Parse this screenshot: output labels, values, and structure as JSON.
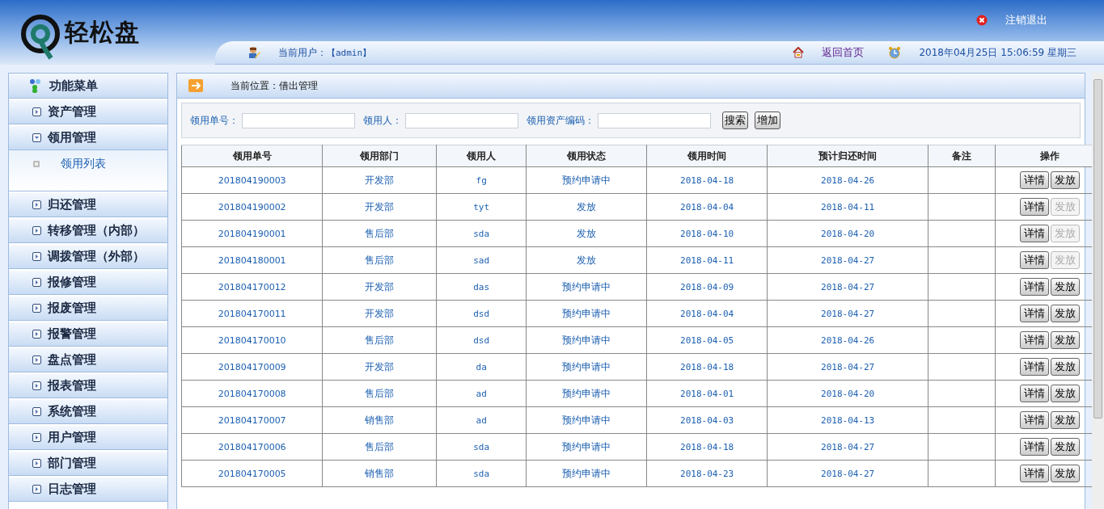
{
  "header": {
    "logo_text": "轻松盘",
    "logout": "注销退出",
    "current_user_label": "当前用户：",
    "current_user": "【admin】",
    "home_link": "返回首页",
    "datetime": "2018年04月25日 15:06:59 星期三"
  },
  "sidebar": {
    "title": "功能菜单",
    "items": [
      {
        "label": "资产管理",
        "expanded": false
      },
      {
        "label": "领用管理",
        "expanded": true,
        "children": [
          {
            "label": "领用列表"
          }
        ]
      },
      {
        "label": "归还管理",
        "expanded": false
      },
      {
        "label": "转移管理（内部）",
        "expanded": false
      },
      {
        "label": "调拨管理（外部）",
        "expanded": false
      },
      {
        "label": "报修管理",
        "expanded": false
      },
      {
        "label": "报废管理",
        "expanded": false
      },
      {
        "label": "报警管理",
        "expanded": false
      },
      {
        "label": "盘点管理",
        "expanded": false
      },
      {
        "label": "报表管理",
        "expanded": false
      },
      {
        "label": "系统管理",
        "expanded": false
      },
      {
        "label": "用户管理",
        "expanded": false
      },
      {
        "label": "部门管理",
        "expanded": false
      },
      {
        "label": "日志管理",
        "expanded": false
      }
    ]
  },
  "breadcrumb": "当前位置：借出管理",
  "search": {
    "fields": [
      {
        "label": "领用单号："
      },
      {
        "label": "领用人："
      },
      {
        "label": "领用资产编码："
      }
    ],
    "buttons": [
      "搜索",
      "增加"
    ]
  },
  "table": {
    "columns": [
      "领用单号",
      "领用部门",
      "领用人",
      "领用状态",
      "领用时间",
      "预计归还时间",
      "备注",
      "操作"
    ],
    "rows": [
      {
        "cells": [
          "201804190003",
          "开发部",
          "fg",
          "预约申请中",
          "2018-04-18",
          "2018-04-26",
          ""
        ],
        "actions": [
          {
            "label": "详情",
            "disabled": false
          },
          {
            "label": "发放",
            "disabled": false
          }
        ]
      },
      {
        "cells": [
          "201804190002",
          "开发部",
          "tyt",
          "发放",
          "2018-04-04",
          "2018-04-11",
          ""
        ],
        "actions": [
          {
            "label": "详情",
            "disabled": false
          },
          {
            "label": "发放",
            "disabled": true
          }
        ]
      },
      {
        "cells": [
          "201804190001",
          "售后部",
          "sda",
          "发放",
          "2018-04-10",
          "2018-04-20",
          ""
        ],
        "actions": [
          {
            "label": "详情",
            "disabled": false
          },
          {
            "label": "发放",
            "disabled": true
          }
        ]
      },
      {
        "cells": [
          "201804180001",
          "售后部",
          "sad",
          "发放",
          "2018-04-11",
          "2018-04-27",
          ""
        ],
        "actions": [
          {
            "label": "详情",
            "disabled": false
          },
          {
            "label": "发放",
            "disabled": true
          }
        ]
      },
      {
        "cells": [
          "201804170012",
          "开发部",
          "das",
          "预约申请中",
          "2018-04-09",
          "2018-04-27",
          ""
        ],
        "actions": [
          {
            "label": "详情",
            "disabled": false
          },
          {
            "label": "发放",
            "disabled": false
          }
        ]
      },
      {
        "cells": [
          "201804170011",
          "开发部",
          "dsd",
          "预约申请中",
          "2018-04-04",
          "2018-04-27",
          ""
        ],
        "actions": [
          {
            "label": "详情",
            "disabled": false
          },
          {
            "label": "发放",
            "disabled": false
          }
        ]
      },
      {
        "cells": [
          "201804170010",
          "售后部",
          "dsd",
          "预约申请中",
          "2018-04-05",
          "2018-04-26",
          ""
        ],
        "actions": [
          {
            "label": "详情",
            "disabled": false
          },
          {
            "label": "发放",
            "disabled": false
          }
        ]
      },
      {
        "cells": [
          "201804170009",
          "开发部",
          "da",
          "预约申请中",
          "2018-04-18",
          "2018-04-27",
          ""
        ],
        "actions": [
          {
            "label": "详情",
            "disabled": false
          },
          {
            "label": "发放",
            "disabled": false
          }
        ]
      },
      {
        "cells": [
          "201804170008",
          "售后部",
          "ad",
          "预约申请中",
          "2018-04-01",
          "2018-04-20",
          ""
        ],
        "actions": [
          {
            "label": "详情",
            "disabled": false
          },
          {
            "label": "发放",
            "disabled": false
          }
        ]
      },
      {
        "cells": [
          "201804170007",
          "销售部",
          "ad",
          "预约申请中",
          "2018-04-03",
          "2018-04-13",
          ""
        ],
        "actions": [
          {
            "label": "详情",
            "disabled": false
          },
          {
            "label": "发放",
            "disabled": false
          }
        ]
      },
      {
        "cells": [
          "201804170006",
          "售后部",
          "sda",
          "预约申请中",
          "2018-04-18",
          "2018-04-27",
          ""
        ],
        "actions": [
          {
            "label": "详情",
            "disabled": false
          },
          {
            "label": "发放",
            "disabled": false
          }
        ]
      },
      {
        "cells": [
          "201804170005",
          "销售部",
          "sda",
          "预约申请中",
          "2018-04-23",
          "2018-04-27",
          ""
        ],
        "actions": [
          {
            "label": "详情",
            "disabled": false
          },
          {
            "label": "发放",
            "disabled": false
          }
        ]
      }
    ]
  }
}
